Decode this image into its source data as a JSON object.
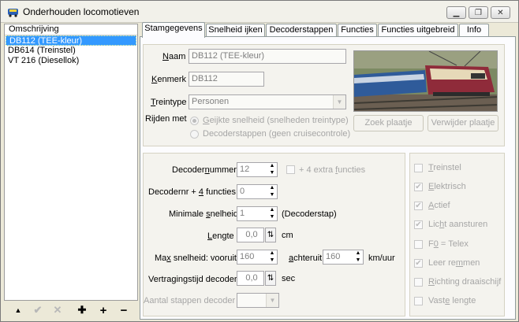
{
  "window": {
    "title": "Onderhouden locomotieven"
  },
  "left_panel": {
    "header": "Omschrijving",
    "items": [
      {
        "label": "DB112 (TEE-kleur)"
      },
      {
        "label": "DB614 (Treinstel)"
      },
      {
        "label": "VT 216 (Diesellok)"
      }
    ],
    "toolbar": {
      "up": "▲",
      "confirm": "✔",
      "cancel": "✕",
      "add_multi": "✚",
      "add": "+",
      "remove": "−"
    }
  },
  "tabs": [
    "Stamgegevens",
    "Snelheid ijken",
    "Decoderstappen",
    "Functies",
    "Functies uitgebreid",
    "Info"
  ],
  "general": {
    "naam_label_u": "N",
    "naam_label_rest": "aam",
    "naam_value": "DB112 (TEE-kleur)",
    "kenmerk_label_u": "K",
    "kenmerk_label_rest": "enmerk",
    "kenmerk_value": "DB112",
    "treintype_label_u": "T",
    "treintype_label_rest": "reintype",
    "treintype_value": "Personen",
    "rijden_met_label": "Rijden met",
    "radio_geijkt_u": "G",
    "radio_geijkt_rest": "eijkte snelheid (snelheden treintype)",
    "radio_decoder": "Decoderstappen (geen cruisecontrole)",
    "zoek_btn": "Zoek plaatje",
    "verwijder_btn": "Verwijder plaatje"
  },
  "decoder": {
    "nummer_label_pre": "Decoder",
    "nummer_label_u": "n",
    "nummer_label_post": "ummer",
    "nummer_value": "12",
    "extra_label": "+ 4 extra ",
    "extra_label_u": "f",
    "extra_label_post": "uncties",
    "plus4_label_pre": "Decodernr + ",
    "plus4_label_u": "4",
    "plus4_label_post": " functies",
    "plus4_value": "0",
    "minimale_label_pre": "Minimale ",
    "minimale_label_u": "s",
    "minimale_label_post": "nelheid",
    "minimale_value": "1",
    "minimale_unit": "(Decoderstap)",
    "lengte_label_u": "L",
    "lengte_label_rest": "engte",
    "lengte_value": "0,0",
    "lengte_unit": "cm",
    "max_label_pre": "Ma",
    "max_label_u": "x",
    "max_label_post": " snelheid: vooruit",
    "max_value": "160",
    "achteruit_label_u": "a",
    "achteruit_label_rest": "chteruit",
    "achteruit_value": "160",
    "speed_unit": "km/uur",
    "vertraging_label": "Vertragingstijd decoder",
    "vertraging_value": "0,0",
    "vertraging_unit": "sec",
    "aantal_label": "Aantal stappen decoder"
  },
  "flags": [
    {
      "label_u": "T",
      "label_rest": "reinstel",
      "checked": false
    },
    {
      "label_u": "E",
      "label_rest": "lektrisch",
      "checked": true
    },
    {
      "label_u": "A",
      "label_rest": "ctief",
      "checked": true
    },
    {
      "label_pre": "Lic",
      "label_u": "h",
      "label_rest": "t aansturen",
      "checked": true
    },
    {
      "label_pre": "F",
      "label_u": "0",
      "label_rest": " = Telex",
      "checked": false
    },
    {
      "label_pre": "Leer re",
      "label_u": "m",
      "label_rest": "men",
      "checked": true
    },
    {
      "label_u": "R",
      "label_rest": "ichting draaischijf",
      "checked": false
    },
    {
      "label_pre": "Vast",
      "label_u": "e",
      "label_rest": " lengte",
      "checked": false
    }
  ],
  "colors": {
    "selection": "#3399ff",
    "panel": "#ece9d8",
    "tab_bg": "#fcfcfe"
  }
}
